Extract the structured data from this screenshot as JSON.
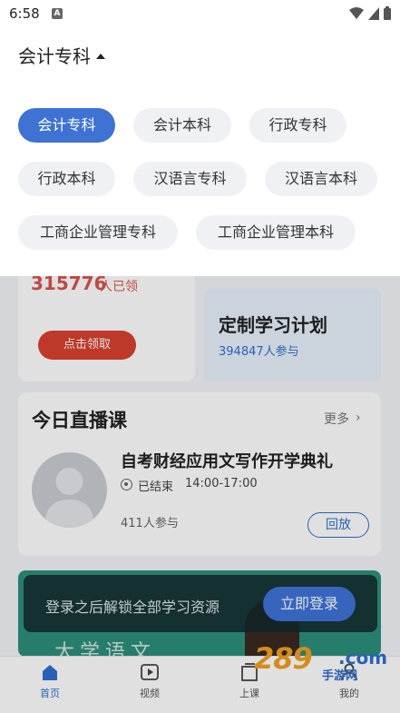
{
  "status_bar": {
    "time": "6:58",
    "notification": "A"
  },
  "dropdown": {
    "title": "会计专科",
    "options": [
      "会计专科",
      "会计本科",
      "行政专科",
      "行政本科",
      "汉语言专科",
      "汉语言本科",
      "工商企业管理专科",
      "工商企业管理本科"
    ],
    "selected_index": 0
  },
  "promo": {
    "count": "315776",
    "count_unit": "人已领",
    "claim_button": "点击领取",
    "plan_title": "定制学习计划",
    "plan_subtitle": "394847人参与"
  },
  "live": {
    "section_title": "今日直播课",
    "more_label": "更多",
    "course_title": "自考财经应用文写作开学典礼",
    "status": "已结束",
    "time": "14:00-17:00",
    "participants": "411人参与",
    "replay_button": "回放"
  },
  "banner": {
    "text": "大学语文",
    "login_prompt": "登录之后解锁全部学习资源",
    "login_button": "立即登录"
  },
  "tabbar": {
    "items": [
      {
        "label": "首页",
        "icon": "home-icon",
        "active": true
      },
      {
        "label": "视频",
        "icon": "video-icon",
        "active": false
      },
      {
        "label": "上课",
        "icon": "class-icon",
        "active": false
      },
      {
        "label": "我的",
        "icon": "profile-icon",
        "active": false
      }
    ]
  },
  "watermark": {
    "brand": "289",
    "domain": ".com",
    "subtitle": "手游网"
  },
  "colors": {
    "accent": "#3e72d3",
    "promo_red": "#d9412f",
    "banner_green": "#2d8f7c"
  }
}
